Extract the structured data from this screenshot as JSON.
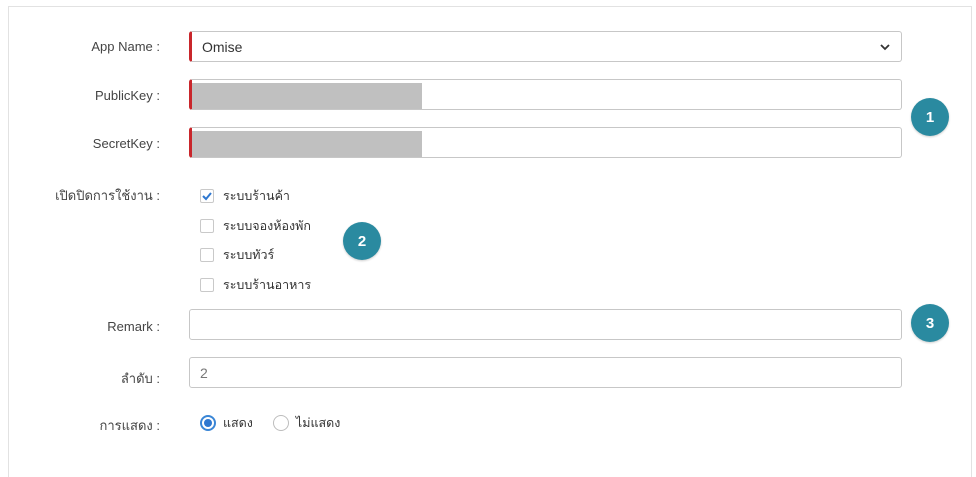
{
  "form": {
    "app_name": {
      "label": "App Name :",
      "value": "Omise"
    },
    "public_key": {
      "label": "PublicKey :"
    },
    "secret_key": {
      "label": "SecretKey :"
    },
    "enable": {
      "label": "เปิดปิดการใช้งาน :",
      "options": [
        {
          "label": "ระบบร้านค้า",
          "checked": true
        },
        {
          "label": "ระบบจองห้องพัก",
          "checked": false
        },
        {
          "label": "ระบบทัวร์",
          "checked": false
        },
        {
          "label": "ระบบร้านอาหาร",
          "checked": false
        }
      ]
    },
    "remark": {
      "label": "Remark :",
      "value": ""
    },
    "order": {
      "label": "ลำดับ :",
      "value": "2"
    },
    "display": {
      "label": "การแสดง :",
      "options": [
        {
          "label": "แสดง",
          "selected": true
        },
        {
          "label": "ไม่แสดง",
          "selected": false
        }
      ]
    }
  },
  "badges": [
    "1",
    "2",
    "3"
  ],
  "colors": {
    "required": "#c9262b",
    "badge": "#2a8aa0",
    "radio": "#2f78d0",
    "check": "#2f78d0"
  }
}
